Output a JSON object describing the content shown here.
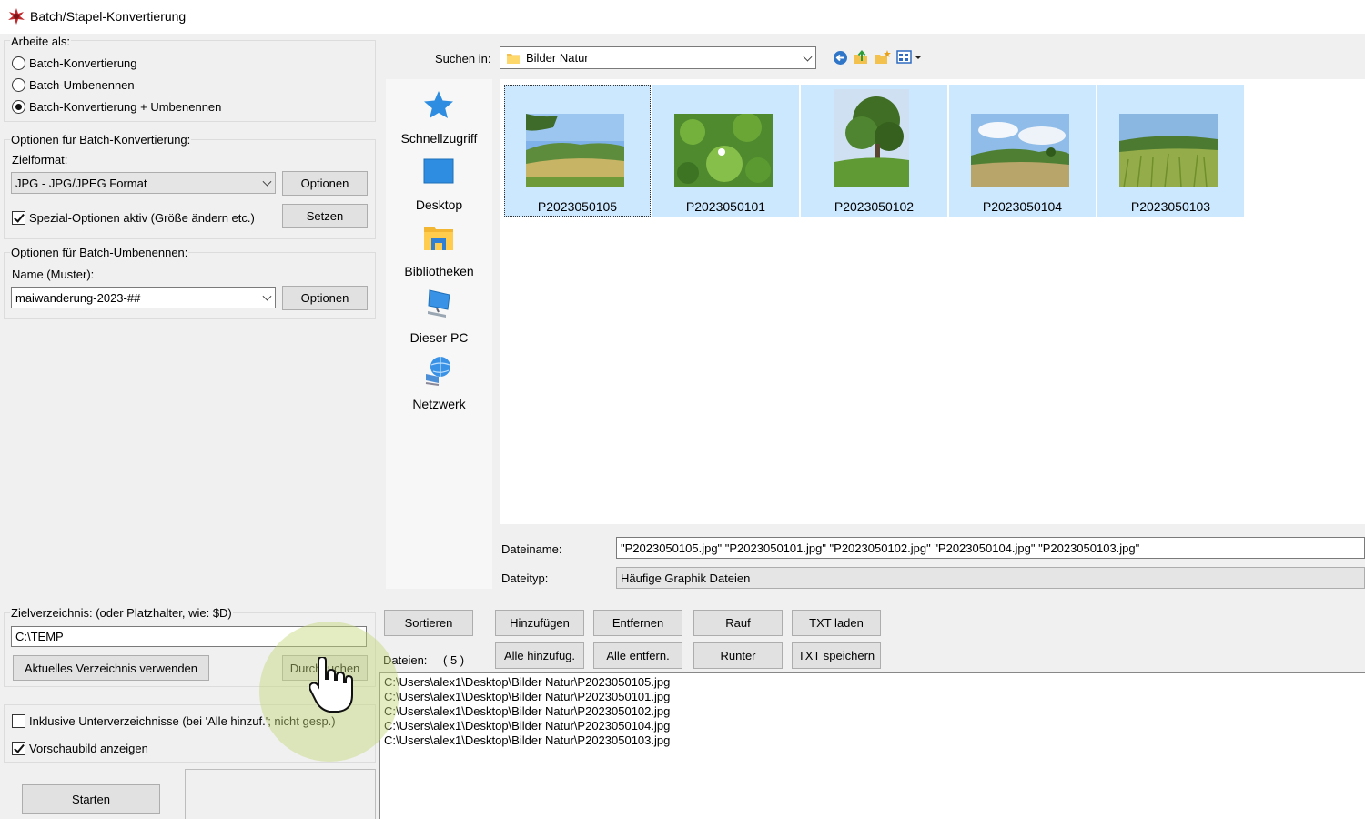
{
  "window": {
    "title": "Batch/Stapel-Konvertierung"
  },
  "work_as": {
    "title": "Arbeite als:",
    "options": [
      {
        "label": "Batch-Konvertierung",
        "selected": false
      },
      {
        "label": "Batch-Umbenennen",
        "selected": false
      },
      {
        "label": "Batch-Konvertierung + Umbenennen",
        "selected": true
      }
    ]
  },
  "convert_opts": {
    "title": "Optionen für Batch-Konvertierung:",
    "format_label": "Zielformat:",
    "format_value": "JPG - JPG/JPEG Format",
    "options_button": "Optionen",
    "special_label": "Spezial-Optionen aktiv (Größe ändern etc.)",
    "special_checked": true,
    "set_button": "Setzen"
  },
  "rename_opts": {
    "title": "Optionen für Batch-Umbenennen:",
    "name_label": "Name (Muster):",
    "name_value": "maiwanderung-2023-##",
    "options_button": "Optionen"
  },
  "target": {
    "title": "Zielverzeichnis: (oder Platzhalter, wie: $D)",
    "value": "C:\\TEMP",
    "use_current_button": "Aktuelles Verzeichnis verwenden",
    "browse_button": "Durchsuchen"
  },
  "include_sub": {
    "label": "Inklusive Unterverzeichnisse (bei 'Alle hinzuf.'; nicht gesp.)",
    "checked": false
  },
  "show_preview": {
    "label": "Vorschaubild anzeigen",
    "checked": true
  },
  "start_button": "Starten",
  "look_in": {
    "label": "Suchen in:",
    "value": "Bilder Natur"
  },
  "places": [
    {
      "label": "Schnellzugriff",
      "icon": "star-icon"
    },
    {
      "label": "Desktop",
      "icon": "desktop-icon"
    },
    {
      "label": "Bibliotheken",
      "icon": "library-icon"
    },
    {
      "label": "Dieser PC",
      "icon": "computer-icon"
    },
    {
      "label": "Netzwerk",
      "icon": "network-icon"
    }
  ],
  "thumbnails": [
    {
      "name": "P2023050105"
    },
    {
      "name": "P2023050101"
    },
    {
      "name": "P2023050102"
    },
    {
      "name": "P2023050104"
    },
    {
      "name": "P2023050103"
    }
  ],
  "filename": {
    "label": "Dateiname:",
    "value": "\"P2023050105.jpg\" \"P2023050101.jpg\" \"P2023050102.jpg\" \"P2023050104.jpg\" \"P2023050103.jpg\""
  },
  "filetype": {
    "label": "Dateityp:",
    "value": "Häufige Graphik Dateien"
  },
  "list_buttons": {
    "sort": "Sortieren",
    "add": "Hinzufügen",
    "remove": "Entfernen",
    "up": "Rauf",
    "load_txt": "TXT laden",
    "add_all": "Alle hinzufüg.",
    "remove_all": "Alle entfern.",
    "down": "Runter",
    "save_txt": "TXT speichern"
  },
  "files": {
    "label": "Dateien:",
    "count": "( 5 )",
    "items": [
      "C:\\Users\\alex1\\Desktop\\Bilder Natur\\P2023050105.jpg",
      "C:\\Users\\alex1\\Desktop\\Bilder Natur\\P2023050101.jpg",
      "C:\\Users\\alex1\\Desktop\\Bilder Natur\\P2023050102.jpg",
      "C:\\Users\\alex1\\Desktop\\Bilder Natur\\P2023050104.jpg",
      "C:\\Users\\alex1\\Desktop\\Bilder Natur\\P2023050103.jpg"
    ]
  },
  "colors": {
    "selection": "#cce8ff",
    "highlight": "#c4d678"
  }
}
